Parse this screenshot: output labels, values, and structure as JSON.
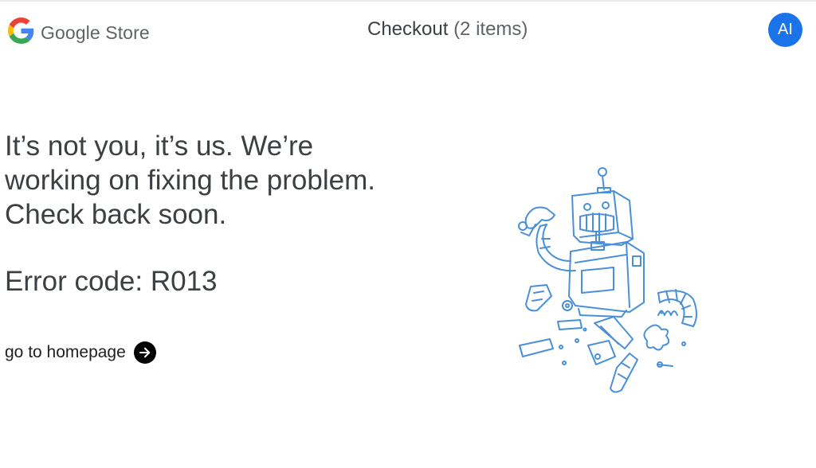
{
  "header": {
    "brand_name": "Google Store",
    "checkout_title": "Checkout",
    "checkout_count": "(2 items)",
    "avatar_initials": "AI"
  },
  "error": {
    "message_lines": [
      "It’s not you, it’s us. We’re",
      "working on fixing the problem.",
      "Check back soon."
    ],
    "code_text": "Error code: R013"
  },
  "links": {
    "homepage_label": "go to homepage"
  },
  "icons": {
    "logo": "google-g-logo",
    "arrow": "arrow-right-icon",
    "illustration": "broken-robot-illustration"
  },
  "colors": {
    "accent": "#1a73e8",
    "text": "#3c4043",
    "sketch": "#4a90d9"
  }
}
